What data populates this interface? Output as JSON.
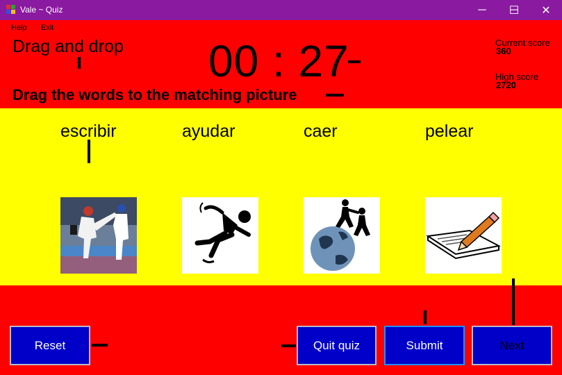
{
  "window": {
    "title": "Vale ~ Quiz",
    "minimize": "─",
    "maximize": "☐",
    "close": "✕"
  },
  "menu": {
    "help": "Help",
    "exit": "Exit"
  },
  "header": {
    "title": "Drag and drop",
    "timer": "00 : 27",
    "instruction": "Drag the words to the matching picture",
    "current_score_label": "Current score",
    "current_score": "360",
    "high_score_label": "High score",
    "high_score": "2720"
  },
  "words": [
    "escribir",
    "ayudar",
    "caer",
    "pelear"
  ],
  "pictures": [
    {
      "icon": "taekwondo-fight-photo"
    },
    {
      "icon": "falling-person-icon"
    },
    {
      "icon": "people-helping-on-globe-icon"
    },
    {
      "icon": "pencil-writing-paper-icon"
    }
  ],
  "buttons": {
    "reset": "Reset",
    "quit": "Quit quiz",
    "submit": "Submit",
    "next": "Next"
  },
  "colors": {
    "top_band": "#ff0000",
    "middle_band": "#ffff00",
    "button": "#0000c8",
    "title_bar": "#8a1aa0"
  }
}
